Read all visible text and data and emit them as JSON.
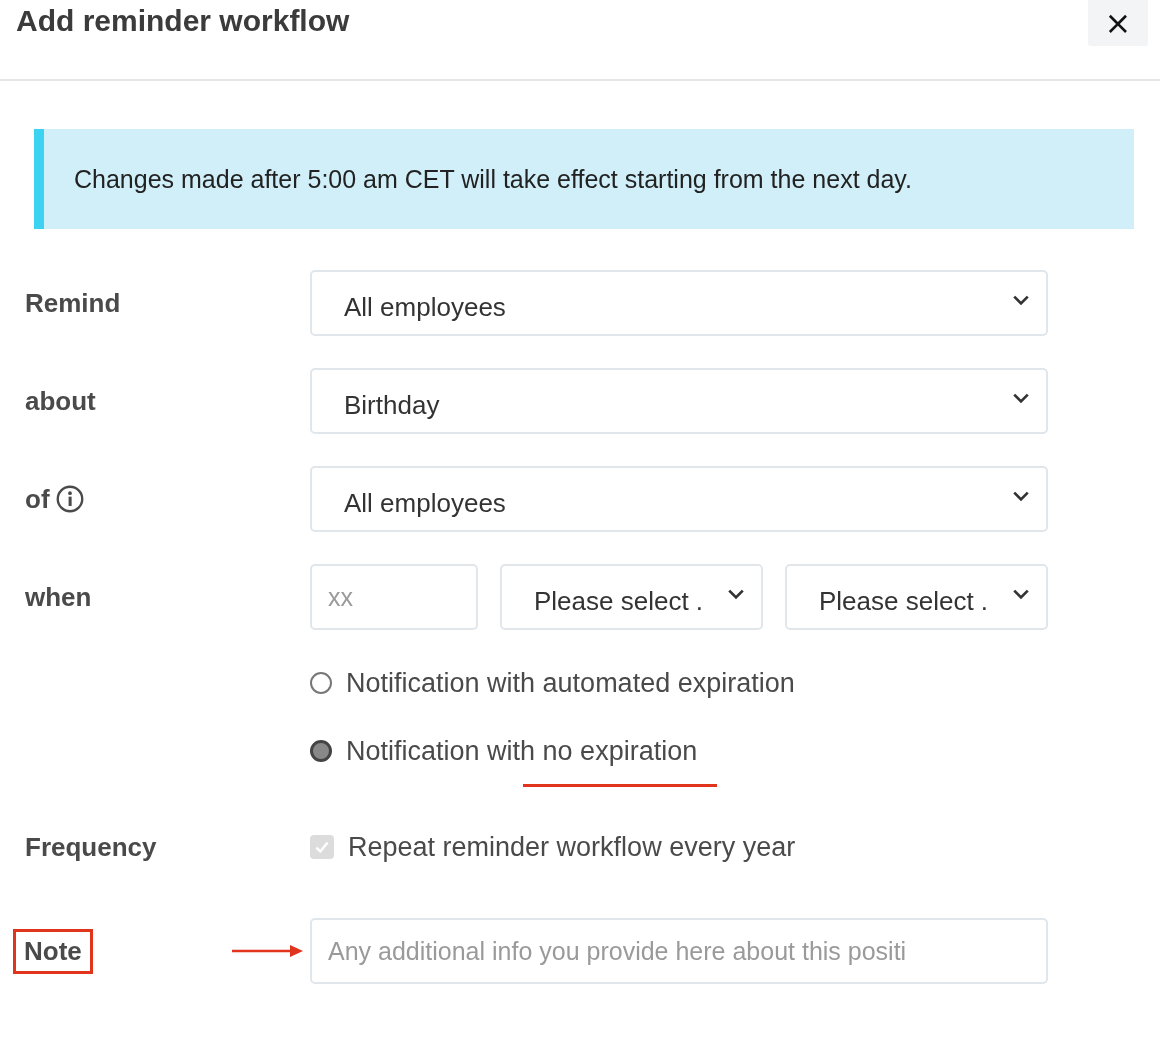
{
  "dialog": {
    "title": "Add reminder workflow",
    "close_label": "×"
  },
  "banner": {
    "text": "Changes made after 5:00 am CET will take effect starting from the next day."
  },
  "rows": [
    {
      "label": "Remind",
      "info": false,
      "controls": [
        {
          "kind": "select",
          "value": "All employees"
        }
      ]
    },
    {
      "label": "about",
      "info": false,
      "controls": [
        {
          "kind": "select",
          "value": "Birthday"
        }
      ]
    },
    {
      "label": "of",
      "info": true,
      "controls": [
        {
          "kind": "select",
          "value": "All employees"
        }
      ]
    },
    {
      "label": "when",
      "info": false,
      "controls": [
        {
          "kind": "input",
          "placeholder": "xx"
        },
        {
          "kind": "select",
          "value": "Please select ."
        },
        {
          "kind": "select",
          "value": "Please select ."
        }
      ]
    }
  ],
  "expiration_options": [
    {
      "label": "Notification with automated expiration",
      "selected": false,
      "underlined": false
    },
    {
      "label": "Notification with no expiration",
      "selected": true,
      "underlined": true
    }
  ],
  "frequency": {
    "label": "Frequency",
    "checkbox_label": "Repeat reminder workflow every year",
    "checked": true,
    "disabled": true
  },
  "note": {
    "label": "Note",
    "placeholder": "Any additional info you provide here about this positi",
    "highlighted": true,
    "arrow": true
  }
}
